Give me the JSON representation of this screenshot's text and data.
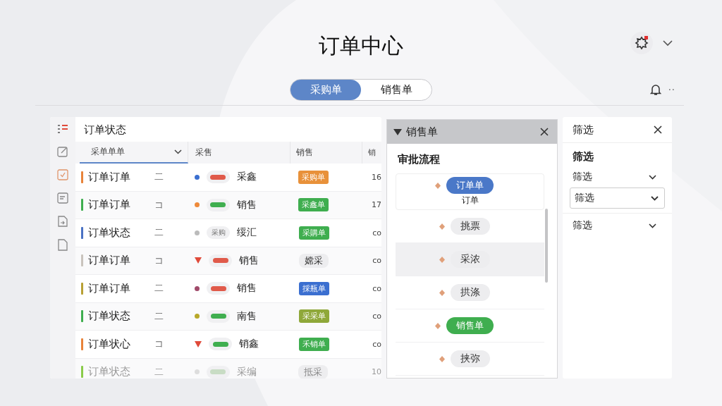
{
  "title": "订单中心",
  "tabs": [
    {
      "label": "采购单",
      "selected": true
    },
    {
      "label": "销售单",
      "selected": false
    }
  ],
  "toolbar": {
    "more": "··"
  },
  "table": {
    "title": "订单状态",
    "columns": [
      {
        "label": "采单单单",
        "sortable": true
      },
      {
        "label": "采售",
        "sortable": false
      },
      {
        "label": "销售",
        "sortable": false
      },
      {
        "label": "销",
        "sortable": false
      }
    ],
    "rows": [
      {
        "color": "#e8833a",
        "name": "订单订单",
        "mark": "二",
        "marker": {
          "kind": "dot",
          "color": "#3b6fd0"
        },
        "pill": {
          "color": "#e05a4a"
        },
        "text": "采鑫",
        "tag": {
          "label": "采购单",
          "color": "#e8913a"
        },
        "col4": "16",
        "dimmed": false
      },
      {
        "color": "#3fae4f",
        "name": "订单订单",
        "mark": "コ",
        "marker": {
          "kind": "dot",
          "color": "#ee8a3a"
        },
        "pill": {
          "color": "#3fae4f"
        },
        "text": "销售",
        "tag": {
          "label": "采鑫单",
          "color": "#3fae4f"
        },
        "col4": "17",
        "dimmed": false
      },
      {
        "color": "#4a72c4",
        "name": "订单状态",
        "mark": "二",
        "marker": {
          "kind": "dot",
          "color": "#bbbbbb"
        },
        "pill": {
          "label": "采购"
        },
        "text": "绥汇",
        "tag": {
          "label": "采購单",
          "color": "#3fae4f"
        },
        "col4": "co",
        "dimmed": false
      },
      {
        "color": "#c9c4bd",
        "name": "订单订单",
        "mark": "コ",
        "marker": {
          "kind": "triangle",
          "color": "#e04a3a"
        },
        "pill": {
          "color": "#e05a4a"
        },
        "text": "销售",
        "tag": {
          "label": "嫦采"
        },
        "col4": "co",
        "dimmed": false
      },
      {
        "color": "#b8a034",
        "name": "订单订单",
        "mark": "二",
        "marker": {
          "kind": "dot",
          "color": "#a04a6a"
        },
        "pill": {
          "color": "#e05a4a"
        },
        "text": "销售",
        "tag": {
          "label": "採瓶单",
          "color": "#3b6fd0"
        },
        "col4": "co",
        "dimmed": false
      },
      {
        "color": "#3fae4f",
        "name": "订单状态",
        "mark": "二",
        "marker": {
          "kind": "dot",
          "color": "#b8a82a"
        },
        "pill": {
          "color": "#3fae4f"
        },
        "text": "南售",
        "tag": {
          "label": "采采单",
          "color": "#8fa83a"
        },
        "col4": "co",
        "dimmed": false
      },
      {
        "color": "#e8833a",
        "name": "订单状心",
        "mark": "コ",
        "marker": {
          "kind": "triangle",
          "color": "#e04a3a"
        },
        "pill": {
          "color": "#3fae4f"
        },
        "text": "销鑫",
        "tag": {
          "label": "禾销单",
          "color": "#3fae4f"
        },
        "col4": "co",
        "dimmed": false
      },
      {
        "color": "#8acb4a",
        "name": "订单状态",
        "mark": "二",
        "marker": {
          "kind": "dot",
          "color": "#dddddd"
        },
        "pill": {
          "color": "#c8dcc4"
        },
        "text": "采编",
        "tag": {
          "label": "抵采"
        },
        "col4": "10",
        "dimmed": true
      }
    ]
  },
  "flow_panel": {
    "title": "销售单",
    "heading": "审批流程",
    "steps": [
      {
        "label": "订单单",
        "color": "#4a78c8",
        "sublabel": "订单",
        "selected": false
      },
      {
        "label": "挑票",
        "selected": false
      },
      {
        "label": "采浓",
        "selected": true
      },
      {
        "label": "拱涤",
        "selected": false
      },
      {
        "label": "销售单",
        "color": "#3fae4f",
        "selected": false
      },
      {
        "label": "挟弥",
        "selected": false
      }
    ]
  },
  "filter_panel": {
    "title": "筛选",
    "heading": "筛选",
    "fields": [
      {
        "label": "筛选",
        "kind": "dropdown"
      },
      {
        "label": "筛选",
        "kind": "select"
      },
      {
        "label": "筛选",
        "kind": "dropdown"
      }
    ]
  }
}
